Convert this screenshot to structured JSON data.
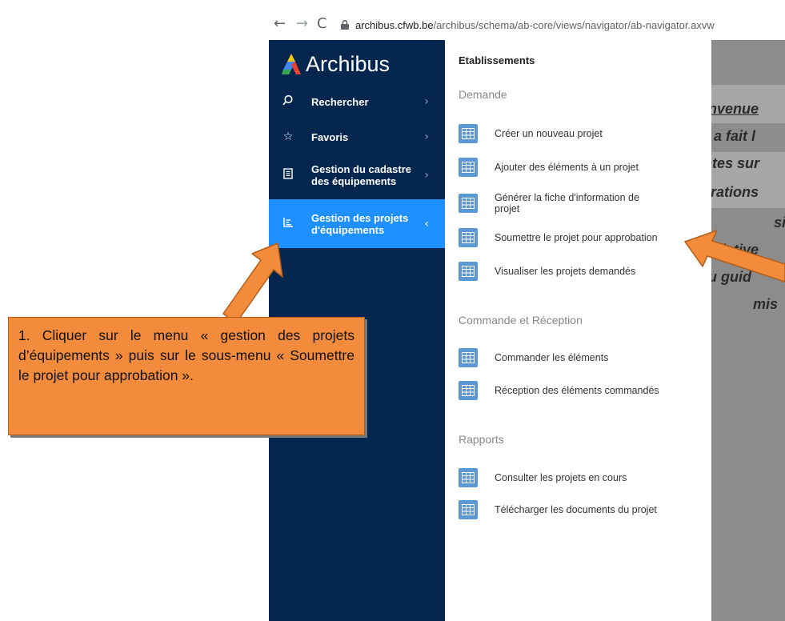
{
  "browser": {
    "back": "←",
    "forward": "→",
    "reload": "C",
    "url_domain": "archibus.cfwb.be",
    "url_path": "/archibus/schema/ab-core/views/navigator/ab-navigator.axvw"
  },
  "sidebar": {
    "logo": "Archibus",
    "items": [
      {
        "label": "Rechercher",
        "icon": "search-icon"
      },
      {
        "label": "Favoris",
        "icon": "star-icon"
      },
      {
        "label_line1": "Gestion du cadastre",
        "label_line2": "des équipements",
        "icon": "document-icon"
      },
      {
        "label_line1": "Gestion des projets",
        "label_line2": "d'équipements",
        "icon": "chart-icon",
        "active": true
      }
    ]
  },
  "panel": {
    "title": "Etablissements",
    "sections": [
      {
        "title": "Demande",
        "entries": [
          "Créer un nouveau projet",
          "Ajouter des éléments à un projet",
          "Générer la fiche d'information de",
          "projet",
          "Soumettre le projet pour approbation",
          "Visualiser les projets demandés"
        ]
      },
      {
        "title": "Commande et Réception",
        "entries": [
          "Commander les éléments",
          "Réception des éléments commandés"
        ]
      },
      {
        "title": "Rapports",
        "entries": [
          "Consulter les projets en cours",
          "Télécharger les documents du projet"
        ]
      }
    ]
  },
  "background_text": [
    "nvenue",
    ": a fait l",
    "ntes sur",
    "orations",
    "si",
    "plative",
    "au guid",
    "mis"
  ],
  "callout": {
    "text": "1. Cliquer sur le menu « gestion des projets d’équipements » puis sur le sous-menu « Soumettre le projet pour approbation »."
  },
  "colors": {
    "sidebar": "#04264f",
    "active": "#1e90ff",
    "callout": "#f28c3c",
    "icon": "#5b97d2"
  }
}
